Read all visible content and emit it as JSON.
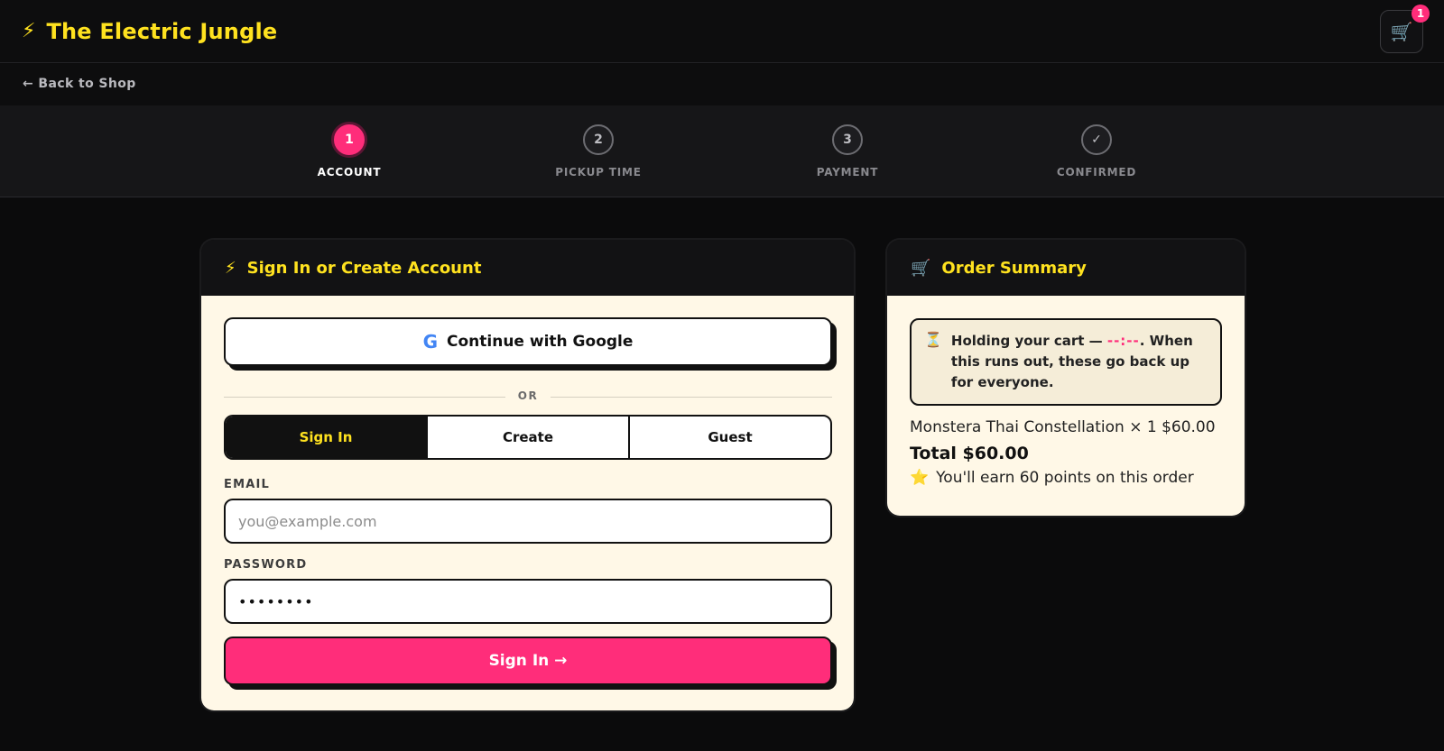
{
  "header": {
    "brand_icon": "bolt-icon",
    "brand_name": "The Electric Jungle",
    "cart_count": "1",
    "cart_icon": "cart-icon"
  },
  "nav": {
    "back_label": "← Back to Shop"
  },
  "stepper": {
    "steps": [
      {
        "number": "1",
        "label": "ACCOUNT",
        "active": true
      },
      {
        "number": "2",
        "label": "PICKUP TIME",
        "active": false
      },
      {
        "number": "3",
        "label": "PAYMENT",
        "active": false
      },
      {
        "number": "✓",
        "label": "CONFIRMED",
        "active": false
      }
    ]
  },
  "account": {
    "title": "Sign In or Create Account",
    "google_label": "Continue with Google",
    "divider": "OR",
    "tabs": [
      "Sign In",
      "Create",
      "Guest"
    ],
    "active_tab": "Sign In",
    "email_label": "EMAIL",
    "email_placeholder": "you@example.com",
    "email_value": "",
    "password_label": "PASSWORD",
    "password_value": "••••••••",
    "submit_label": "Sign In →"
  },
  "summary": {
    "title": "Order Summary",
    "hold_prefix": "Holding your cart — ",
    "hold_timer": "--:--",
    "hold_suffix": ". When this runs out, these go back up for everyone.",
    "line_item": "Monstera Thai Constellation × 1 $60.00",
    "total": "Total $60.00",
    "points": "You'll earn 60 points on this order"
  },
  "colors": {
    "accent_yellow": "#ffe21f",
    "accent_pink": "#ff2d7a",
    "background": "#0b0b0c",
    "card_body": "#fff8e7"
  }
}
